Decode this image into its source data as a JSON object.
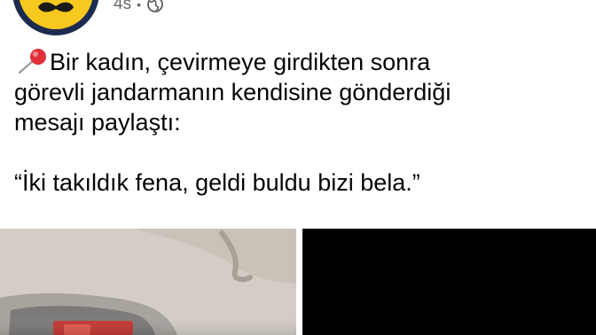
{
  "post": {
    "time": "4s",
    "dot": "•",
    "lines": [
      "Bir kadın, çevirmeye girdikten sonra",
      "görevli jandarmanın kendisine gönderdiği",
      "mesajı paylaştı:"
    ],
    "quote": "“İki takıldık fena, geldi buldu bizi bela.”"
  },
  "icons": {
    "pin": "pushpin-icon",
    "privacy": "globe-icon",
    "avatar": "mustache-logo"
  },
  "colors": {
    "text": "#050505",
    "meta": "#65676b",
    "avatar_yellow": "#f7c81e",
    "avatar_navy": "#1d2b4f",
    "pin_red": "#e0303a"
  }
}
